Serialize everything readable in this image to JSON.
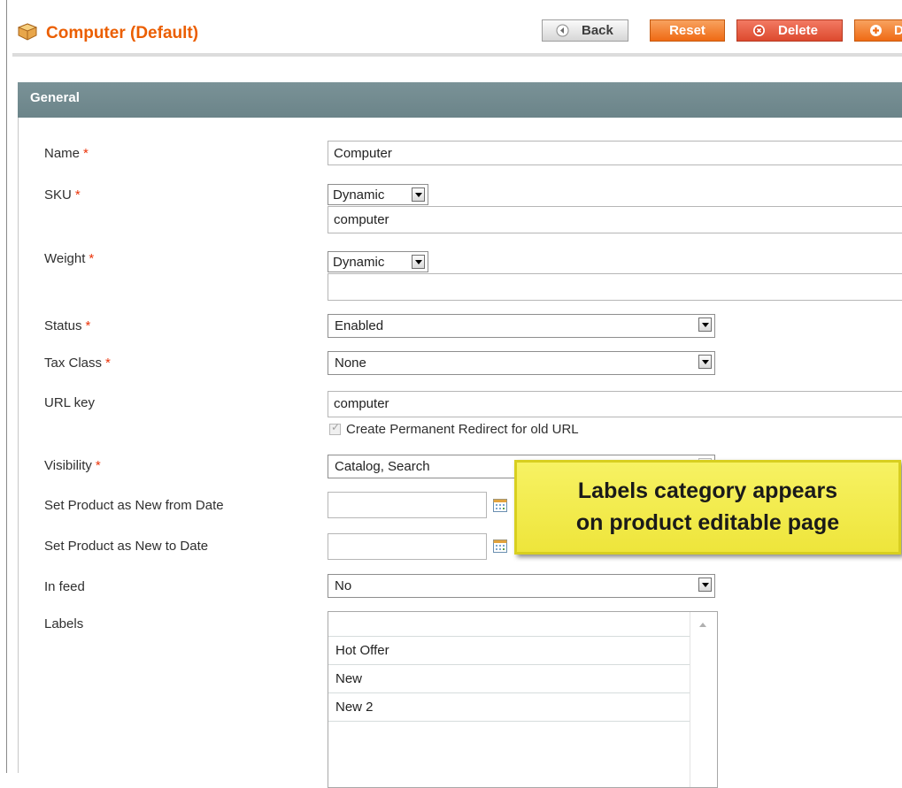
{
  "header": {
    "title": "Computer (Default)",
    "buttons": {
      "back": "Back",
      "reset": "Reset",
      "delete": "Delete",
      "duplicate": "D"
    }
  },
  "section": {
    "title": "General"
  },
  "form": {
    "name": {
      "label": "Name",
      "value": "Computer"
    },
    "sku": {
      "label": "SKU",
      "mode": "Dynamic",
      "value": "computer"
    },
    "weight": {
      "label": "Weight",
      "mode": "Dynamic",
      "value": ""
    },
    "status": {
      "label": "Status",
      "value": "Enabled"
    },
    "tax_class": {
      "label": "Tax Class",
      "value": "None"
    },
    "url_key": {
      "label": "URL key",
      "value": "computer",
      "redirect_label": "Create Permanent Redirect for old URL"
    },
    "visibility": {
      "label": "Visibility",
      "value": "Catalog, Search"
    },
    "new_from": {
      "label": "Set Product as New from Date",
      "value": ""
    },
    "new_to": {
      "label": "Set Product as New to Date",
      "value": ""
    },
    "in_feed": {
      "label": "In feed",
      "value": "No"
    },
    "labels": {
      "label": "Labels",
      "options": [
        "",
        "Hot Offer",
        "New",
        "New 2"
      ]
    },
    "required_mark": "*"
  },
  "callout": {
    "line1": "Labels category appears",
    "line2": "on product editable page"
  },
  "colors": {
    "title": "#eb5e00",
    "section_header": "#6b8489",
    "required": "#eb340a",
    "reset_button": "#ef6a14",
    "delete_button": "#dd4a2e",
    "callout": "#f2ec4a"
  },
  "icons": {
    "title": "product-box-icon",
    "back": "back-arrow-icon",
    "delete": "delete-x-icon",
    "duplicate": "plus-icon",
    "calendar": "calendar-icon"
  }
}
